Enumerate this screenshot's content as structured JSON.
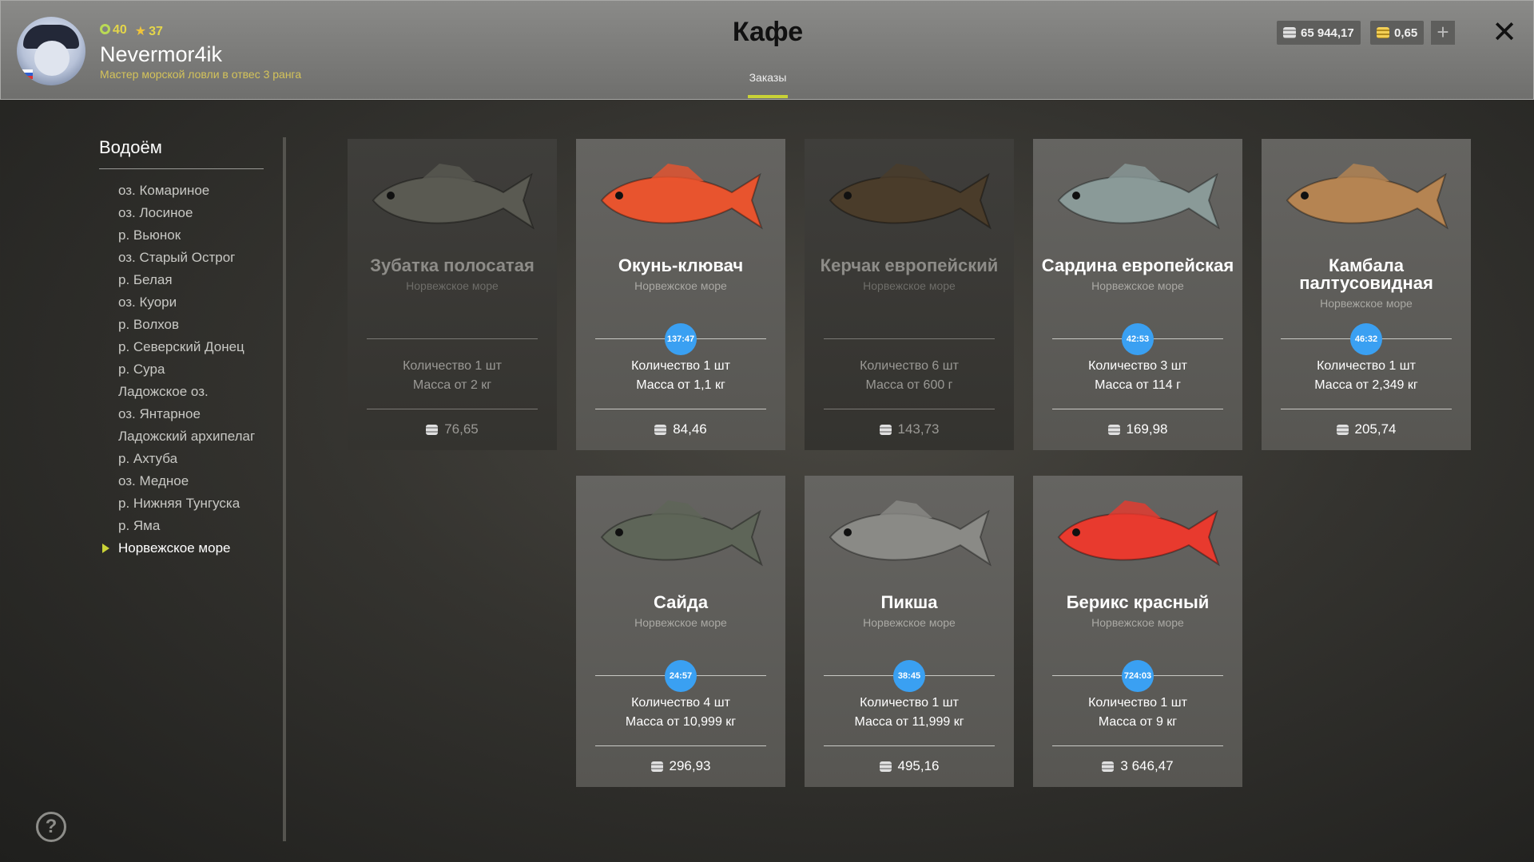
{
  "header": {
    "title": "Кафе",
    "tab": "Заказы",
    "player": {
      "level": "40",
      "rank_points": "37",
      "name": "Nevermor4ik",
      "rank": "Мастер морской ловли в отвес 3 ранга"
    },
    "currency": {
      "silver": "65 944,17",
      "gold": "0,65"
    },
    "icons": {
      "close": "close-icon",
      "add": "plus-icon",
      "help": "help-icon"
    }
  },
  "sidebar": {
    "title": "Водоём",
    "items": [
      {
        "label": "оз. Комариное"
      },
      {
        "label": "оз. Лосиное"
      },
      {
        "label": "р. Вьюнок"
      },
      {
        "label": "оз. Старый Острог"
      },
      {
        "label": "р. Белая"
      },
      {
        "label": "оз. Куори"
      },
      {
        "label": "р. Волхов"
      },
      {
        "label": "р. Северский Донец"
      },
      {
        "label": "р. Сура"
      },
      {
        "label": "Ладожское оз."
      },
      {
        "label": "оз. Янтарное"
      },
      {
        "label": "Ладожский архипелаг"
      },
      {
        "label": "р. Ахтуба"
      },
      {
        "label": "оз. Медное"
      },
      {
        "label": "р. Нижняя Тунгуска"
      },
      {
        "label": "р. Яма"
      },
      {
        "label": "Норвежское море",
        "active": true
      }
    ]
  },
  "orders": [
    {
      "name": "Зубатка полосатая",
      "location": "Норвежское море",
      "timer": "",
      "quantity": "Количество 1 шт",
      "mass": "Масса от 2 кг",
      "price": "76,65",
      "available": false,
      "fish_color": "#5a5a52",
      "fish_icon": "catfish-icon"
    },
    {
      "name": "Окунь-клювач",
      "location": "Норвежское море",
      "timer": "137:47",
      "quantity": "Количество 1 шт",
      "mass": "Масса от 1,1 кг",
      "price": "84,46",
      "available": true,
      "fish_color": "#e8542e",
      "fish_icon": "redfish-icon"
    },
    {
      "name": "Керчак европейский",
      "location": "Норвежское море",
      "timer": "",
      "quantity": "Количество 6 шт",
      "mass": "Масса от 600 г",
      "price": "143,73",
      "available": false,
      "fish_color": "#4a3c2a",
      "fish_icon": "sculpin-icon"
    },
    {
      "name": "Сардина европейская",
      "location": "Норвежское море",
      "timer": "42:53",
      "quantity": "Количество 3 шт",
      "mass": "Масса от 114 г",
      "price": "169,98",
      "available": true,
      "fish_color": "#8a9a98",
      "fish_icon": "sardine-icon"
    },
    {
      "name": "Камбала палтусовидная",
      "location": "Норвежское море",
      "timer": "46:32",
      "quantity": "Количество 1 шт",
      "mass": "Масса от 2,349 кг",
      "price": "205,74",
      "available": true,
      "fish_color": "#b58452",
      "fish_icon": "flounder-icon"
    },
    {
      "name": "Сайда",
      "location": "Норвежское море",
      "timer": "24:57",
      "quantity": "Количество 4 шт",
      "mass": "Масса от 10,999 кг",
      "price": "296,93",
      "available": true,
      "fish_color": "#5e6558",
      "fish_icon": "pollock-icon"
    },
    {
      "name": "Пикша",
      "location": "Норвежское море",
      "timer": "38:45",
      "quantity": "Количество 1 шт",
      "mass": "Масса от 11,999 кг",
      "price": "495,16",
      "available": true,
      "fish_color": "#8a8a86",
      "fish_icon": "haddock-icon"
    },
    {
      "name": "Берикс красный",
      "location": "Норвежское море",
      "timer": "724:03",
      "quantity": "Количество 1 шт",
      "mass": "Масса от 9 кг",
      "price": "3 646,47",
      "available": true,
      "fish_color": "#e83a2e",
      "fish_icon": "alfonsino-icon"
    }
  ]
}
